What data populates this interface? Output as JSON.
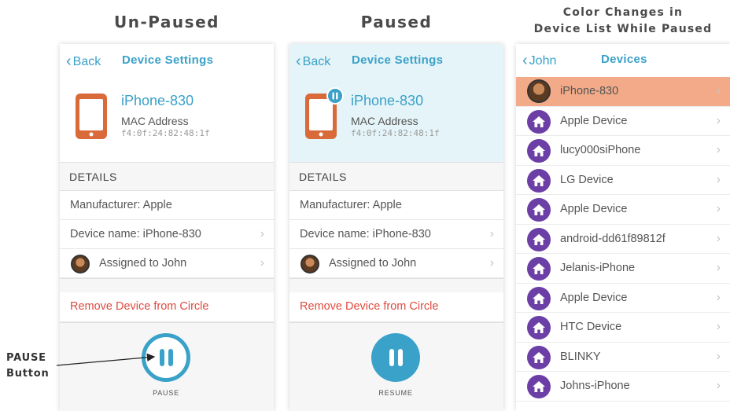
{
  "headings": {
    "unpaused": "Un-Paused",
    "paused": "Paused",
    "list_line1": "Color Changes in",
    "list_line2": "Device List While Paused"
  },
  "annotation": {
    "line1": "PAUSE",
    "line2": "Button"
  },
  "screen_settings": {
    "back_label": "Back",
    "title": "Device Settings",
    "device_name": "iPhone-830",
    "mac_label": "MAC Address",
    "mac_value": "f4:0f:24:82:48:1f",
    "details_header": "DETAILS",
    "manufacturer": "Manufacturer: Apple",
    "device_name_row": "Device name: iPhone-830",
    "assigned_to": "Assigned to John",
    "remove_label": "Remove Device from Circle",
    "pause_caption": "PAUSE",
    "resume_caption": "RESUME"
  },
  "screen_list": {
    "back_label": "John",
    "title": "Devices",
    "items": [
      {
        "label": "iPhone-830",
        "state": "paused"
      },
      {
        "label": "Apple Device",
        "state": "normal"
      },
      {
        "label": "lucy000siPhone",
        "state": "normal"
      },
      {
        "label": "LG Device",
        "state": "normal"
      },
      {
        "label": "Apple Device",
        "state": "normal"
      },
      {
        "label": "android-dd61f89812f",
        "state": "normal"
      },
      {
        "label": "Jelanis-iPhone",
        "state": "normal"
      },
      {
        "label": "Apple Device",
        "state": "normal"
      },
      {
        "label": "HTC Device",
        "state": "normal"
      },
      {
        "label": "BLINKY",
        "state": "normal"
      },
      {
        "label": "Johns-iPhone",
        "state": "normal"
      }
    ]
  },
  "colors": {
    "accent": "#3aa1c9",
    "device_orange": "#d96a3a",
    "remove_red": "#e04a3f",
    "paused_header_bg": "#e4f4f8",
    "paused_row_bg": "#f2aa88",
    "home_purple": "#6b3fa6"
  },
  "icons": {
    "back": "chevron-left-icon",
    "row": "chevron-right-icon",
    "device": "phone-icon",
    "paused_badge": "pause-badge-icon",
    "pause": "pause-icon",
    "list_device": "home-icon"
  }
}
